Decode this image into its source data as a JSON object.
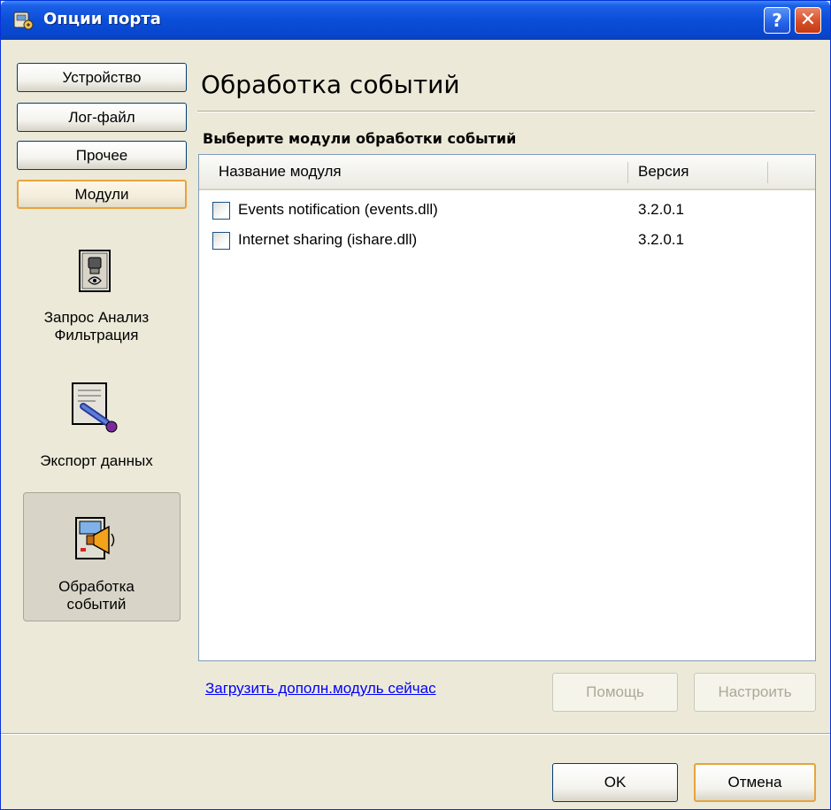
{
  "window": {
    "title": "Опции порта"
  },
  "titlebar": {
    "help_glyph": "?",
    "close_glyph": "✕"
  },
  "tabs": [
    {
      "label": "Устройство"
    },
    {
      "label": "Лог-файл"
    },
    {
      "label": "Прочее"
    },
    {
      "label": "Модули",
      "active": true
    }
  ],
  "sidebar_items": [
    {
      "label_line1": "Запрос Анализ",
      "label_line2": "Фильтрация",
      "icon": "query-analysis-icon"
    },
    {
      "label_line1": "Экспорт данных",
      "icon": "data-export-icon"
    },
    {
      "label_line1": "Обработка",
      "label_line2": "событий",
      "icon": "event-processing-icon",
      "selected": true
    }
  ],
  "main": {
    "heading": "Обработка событий",
    "section_label": "Выберите модули обработки событий",
    "columns": {
      "name": "Название модуля",
      "version": "Версия"
    },
    "rows": [
      {
        "name": "Events notification (events.dll)",
        "version": "3.2.0.1",
        "checked": false
      },
      {
        "name": "Internet sharing (ishare.dll)",
        "version": "3.2.0.1",
        "checked": false
      }
    ],
    "link_text": "Загрузить дополн.модуль сейчас",
    "help_button": "Помощь",
    "configure_button": "Настроить"
  },
  "footer": {
    "ok_button": "OK",
    "cancel_button": "Отмена"
  },
  "colors": {
    "titlebar_blue": "#0a4ed8",
    "face": "#ece9d8",
    "focus_orange": "#e8a33c",
    "link_blue": "#0000ff"
  }
}
